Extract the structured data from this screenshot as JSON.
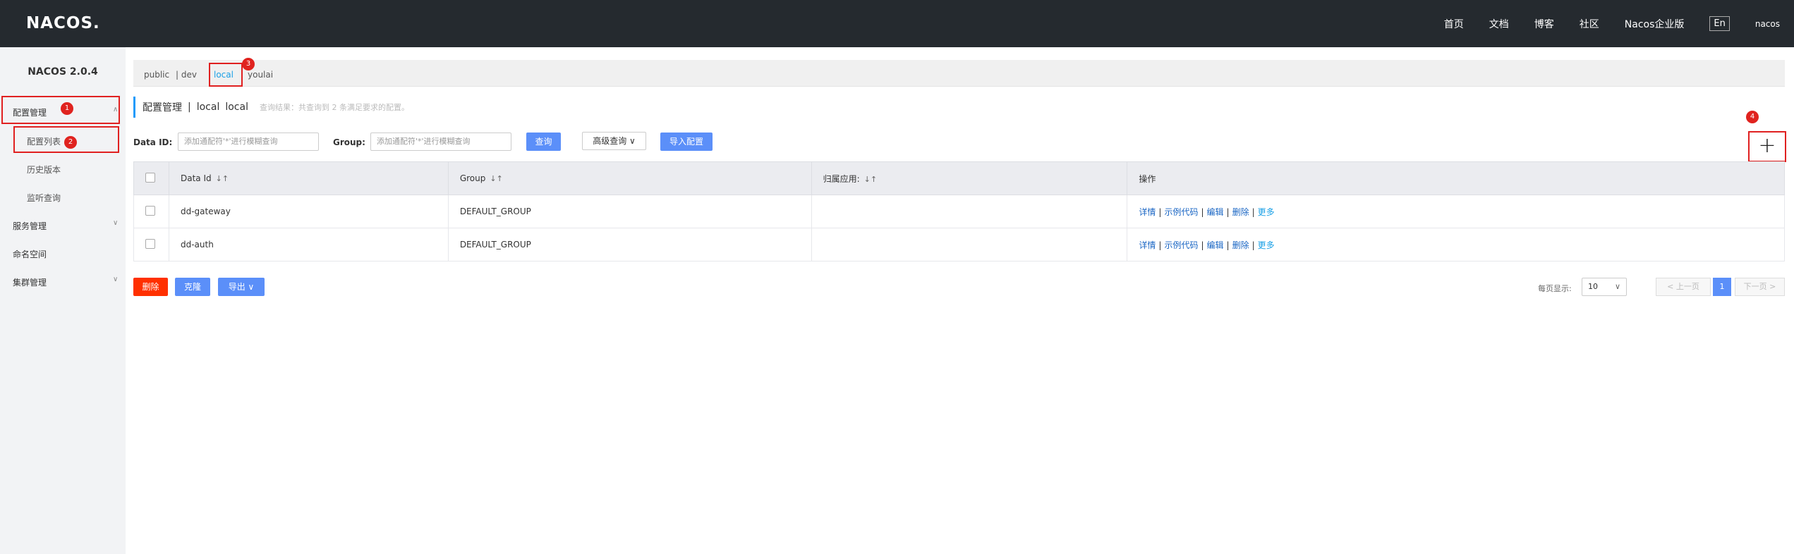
{
  "topbar": {
    "logo": "NACOS.",
    "nav": [
      "首页",
      "文档",
      "博客",
      "社区",
      "Nacos企业版"
    ],
    "lang": "En",
    "user": "nacos"
  },
  "sidebar": {
    "version": "NACOS 2.0.4",
    "config_mgmt": "配置管理",
    "config_list": "配置列表",
    "history": "历史版本",
    "listen_query": "监听查询",
    "service_mgmt": "服务管理",
    "namespace": "命名空间",
    "cluster_mgmt": "集群管理"
  },
  "badges": {
    "b1": "1",
    "b2": "2",
    "b3": "3",
    "b4": "4"
  },
  "namespaces": {
    "public": "public",
    "dev": "| dev",
    "local": "local",
    "youlai": "youlai",
    "active": "local"
  },
  "title": {
    "main": "配置管理",
    "sep": "|",
    "ns_name": "local",
    "ns_id": "local",
    "hint": "查询结果：共查询到 2 条满足要求的配置。"
  },
  "search": {
    "dataid_label": "Data ID:",
    "dataid_placeholder": "添加通配符'*'进行模糊查询",
    "group_label": "Group:",
    "group_placeholder": "添加通配符'*'进行模糊查询",
    "query_btn": "查询",
    "advanced_btn": "高级查询 ∨",
    "import_btn": "导入配置"
  },
  "add_icon": "+",
  "table": {
    "headers": {
      "dataid": "Data Id",
      "group": "Group",
      "app": "归属应用:",
      "ops": "操作"
    },
    "rows": [
      {
        "dataid": "dd-gateway",
        "group": "DEFAULT_GROUP",
        "app": ""
      },
      {
        "dataid": "dd-auth",
        "group": "DEFAULT_GROUP",
        "app": ""
      }
    ],
    "ops": {
      "detail": "详情",
      "sample": "示例代码",
      "edit": "编辑",
      "delete": "删除",
      "more": "更多"
    }
  },
  "footer": {
    "delete_btn": "删除",
    "clone_btn": "克隆",
    "export_btn": "导出 ∨",
    "page_size_label": "每页显示:",
    "page_size": "10",
    "prev": "< 上一页",
    "current_page": "1",
    "next": "下一页 >"
  },
  "colors": {
    "topbar": "#252a2f",
    "primary": "#5b8ff9",
    "danger": "#ff3000",
    "highlight_box": "#e02020"
  }
}
